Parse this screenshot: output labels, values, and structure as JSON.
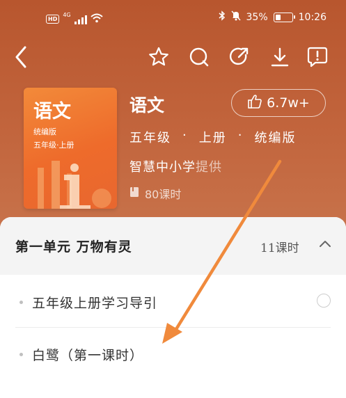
{
  "status_bar": {
    "hd": "HD",
    "network": "4G",
    "battery": "35%",
    "battery_level": 0.35,
    "time": "10:26"
  },
  "nav": {
    "icons": [
      "back-arrow-icon",
      "star-icon",
      "search-icon",
      "share-icon",
      "download-icon",
      "feedback-icon"
    ]
  },
  "book": {
    "cover_title": "语文",
    "cover_edition": "统编版",
    "cover_grade": "五年级·上册",
    "title": "语文",
    "likes": "6.7w+",
    "grade": "五年级",
    "volume": "上册",
    "edition": "统编版",
    "separator": "·",
    "provider_name": "智慧中小学",
    "provider_suffix": "提供",
    "lesson_count": "80课时"
  },
  "unit": {
    "title": "第一单元 万物有灵",
    "count": "11课时"
  },
  "lessons": [
    {
      "title": "五年级上册学习导引"
    },
    {
      "title": "白鹭（第一课时）"
    }
  ],
  "colors": {
    "header_bg": "#c2653d",
    "cover": "#ee6b2b",
    "arrow": "#f08a3c"
  }
}
